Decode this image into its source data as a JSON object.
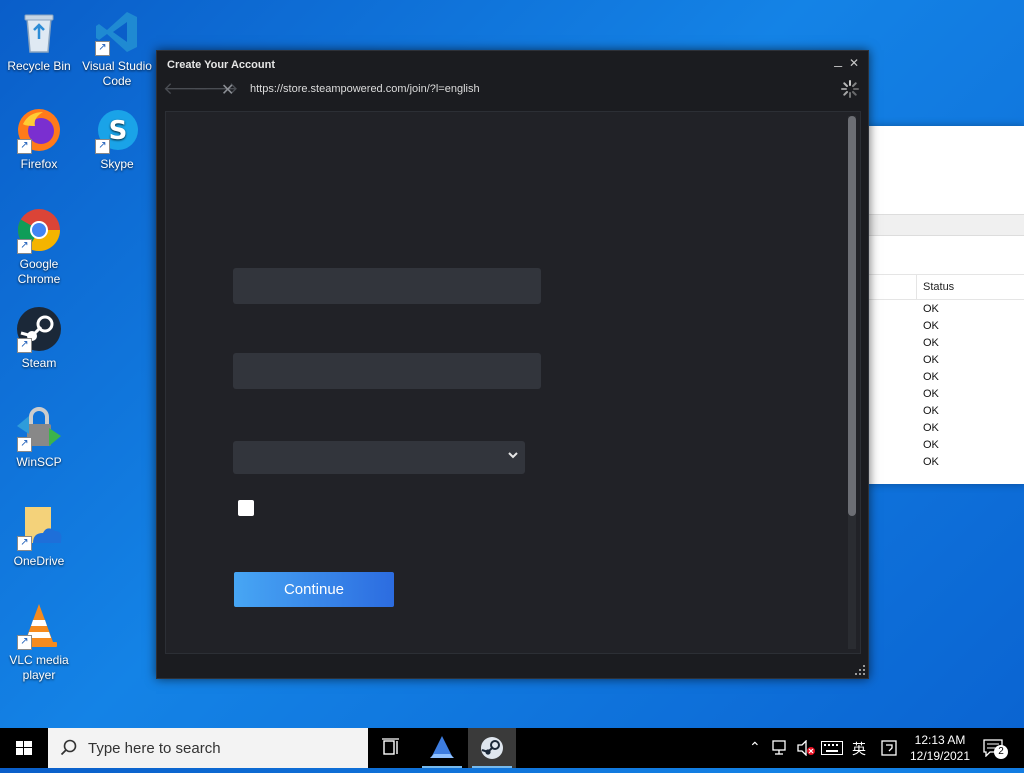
{
  "desktop": {
    "icons": [
      {
        "label": "Recycle Bin"
      },
      {
        "label": "Visual Studio Code"
      },
      {
        "label": "Firefox"
      },
      {
        "label": "Skype"
      },
      {
        "label": "Google Chrome"
      },
      {
        "label": "Steam"
      },
      {
        "label": "WinSCP"
      },
      {
        "label": "OneDrive"
      },
      {
        "label": "VLC media player"
      }
    ]
  },
  "background_window": {
    "column_header": "Status",
    "rows": [
      "OK",
      "OK",
      "OK",
      "OK",
      "OK",
      "OK",
      "OK",
      "OK",
      "OK",
      "OK"
    ]
  },
  "steam_window": {
    "title": "Create Your Account",
    "minimize": "_",
    "close": "✕",
    "url": "https://store.steampowered.com/join/?l=english",
    "continue_label": "Continue",
    "colors": {
      "accent_start": "#47a6f4",
      "accent_end": "#2c6ce0",
      "background": "#1b1c20"
    }
  },
  "taskbar": {
    "search_placeholder": "Type here to search",
    "ime": "英",
    "time": "12:13 AM",
    "date": "12/19/2021",
    "notification_count": "2"
  }
}
